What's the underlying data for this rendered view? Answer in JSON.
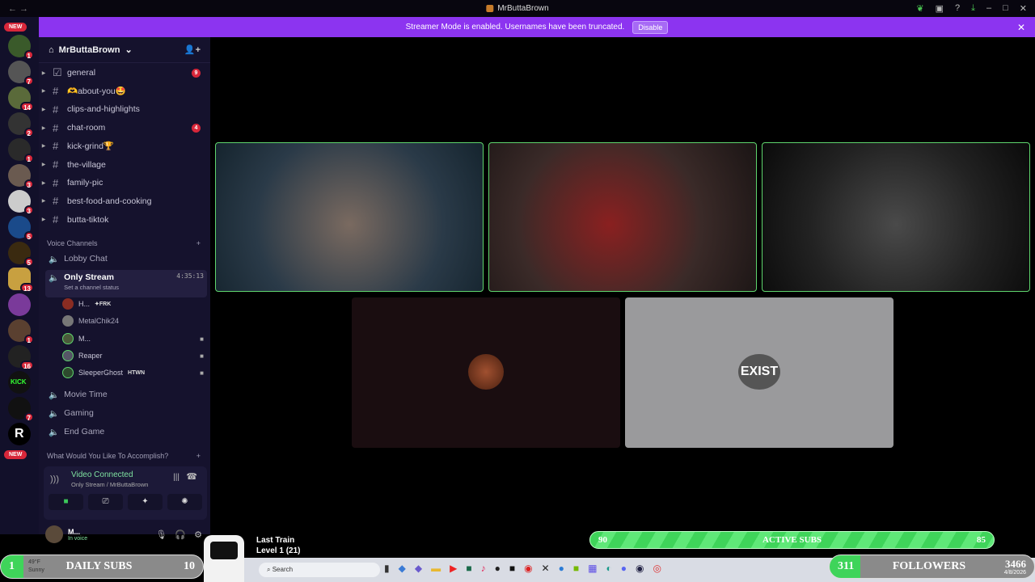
{
  "window": {
    "title": "MrButtaBrown",
    "nav": "← →"
  },
  "banner": {
    "text": "Streamer Mode is enabled. Usernames have been truncated.",
    "button": "Disable"
  },
  "rail": {
    "new_top": "NEW",
    "new_bottom": "NEW",
    "badges": [
      "1",
      "7",
      "14",
      "2",
      "1",
      "3",
      "3",
      "5",
      "5",
      "13",
      "",
      "1",
      "16",
      "",
      "7",
      ""
    ],
    "kick_label": "KICK",
    "r_label": "R"
  },
  "server": {
    "name": "MrButtaBrown"
  },
  "channels": [
    {
      "name": "general",
      "unread": "9"
    },
    {
      "name": "🫶about-you🤩",
      "unread": ""
    },
    {
      "name": "clips-and-highlights",
      "unread": ""
    },
    {
      "name": "chat-room",
      "unread": "4"
    },
    {
      "name": "kick-grind🏆",
      "unread": ""
    },
    {
      "name": "the-village",
      "unread": ""
    },
    {
      "name": "family-pic",
      "unread": ""
    },
    {
      "name": "best-food-and-cooking",
      "unread": ""
    },
    {
      "name": "butta-tiktok",
      "unread": ""
    }
  ],
  "voice": {
    "category": "Voice Channels",
    "channels": [
      "Lobby Chat",
      "Only Stream",
      "Movie Time",
      "Gaming",
      "End Game"
    ],
    "active": {
      "name": "Only Stream",
      "timer": "4:35:13",
      "status": "Set a channel status"
    },
    "users": [
      {
        "name": "H...",
        "tag": "✦FRK"
      },
      {
        "name": "MetalChik24",
        "tag": ""
      },
      {
        "name": "M...",
        "tag": ""
      },
      {
        "name": "Reaper",
        "tag": ""
      },
      {
        "name": "SleeperGhost",
        "tag": "HTWN"
      }
    ],
    "category2": "What Would You Like To Accomplish?"
  },
  "connection": {
    "title": "Video Connected",
    "subtitle": "Only Stream / MrButtaBrown"
  },
  "me": {
    "name": "M...",
    "status": "In voice"
  },
  "tiles": {
    "exist_label": "EXIST"
  },
  "overlay": {
    "active_subs": {
      "left": "90",
      "label": "ACTIVE SUBS",
      "right": "85"
    },
    "daily_subs": {
      "left": "1",
      "label": "DAILY SUBS",
      "right": "10"
    },
    "followers": {
      "left": "311",
      "label": "FOLLOWERS",
      "right": "3466"
    },
    "train": {
      "title": "Last Train",
      "level": "Level 1 (21)"
    },
    "weather": {
      "temp": "49°F",
      "cond": "Sunny"
    }
  },
  "taskbar": {
    "search": "Search",
    "date": "4/8/2026"
  },
  "colors": {
    "accent": "#8c34f0",
    "speaking": "#5fd56d",
    "badge": "#d8273a"
  }
}
